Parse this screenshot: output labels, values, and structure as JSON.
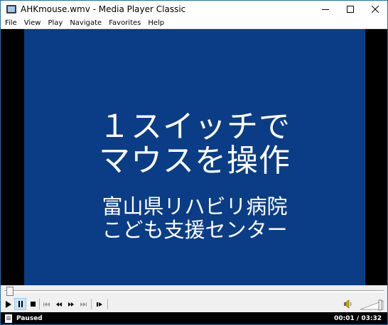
{
  "window": {
    "title": "AHKmouse.wmv - Media Player Classic",
    "controls": [
      "minimize-icon",
      "maximize-icon",
      "close-icon"
    ]
  },
  "menu": {
    "file": "File",
    "view": "View",
    "play": "Play",
    "navigate": "Navigate",
    "favorites": "Favorites",
    "help": "Help"
  },
  "video": {
    "line1": "１スイッチで",
    "line2": "マウスを操作",
    "line3": "富山県リハビリ病院",
    "line4": "こども支援センター",
    "background_color": "#0b3d86"
  },
  "seek": {
    "position_fraction": 0.005
  },
  "toolbar": {
    "buttons": [
      "play-icon",
      "pause-icon",
      "stop-icon",
      "skip-back-icon",
      "rewind-icon",
      "fast-forward-icon",
      "skip-forward-icon",
      "frame-step-icon"
    ],
    "pressed": "pause",
    "volume_icon": "speaker-icon"
  },
  "status": {
    "state": "Paused",
    "time": "00:01 / 03:32"
  }
}
